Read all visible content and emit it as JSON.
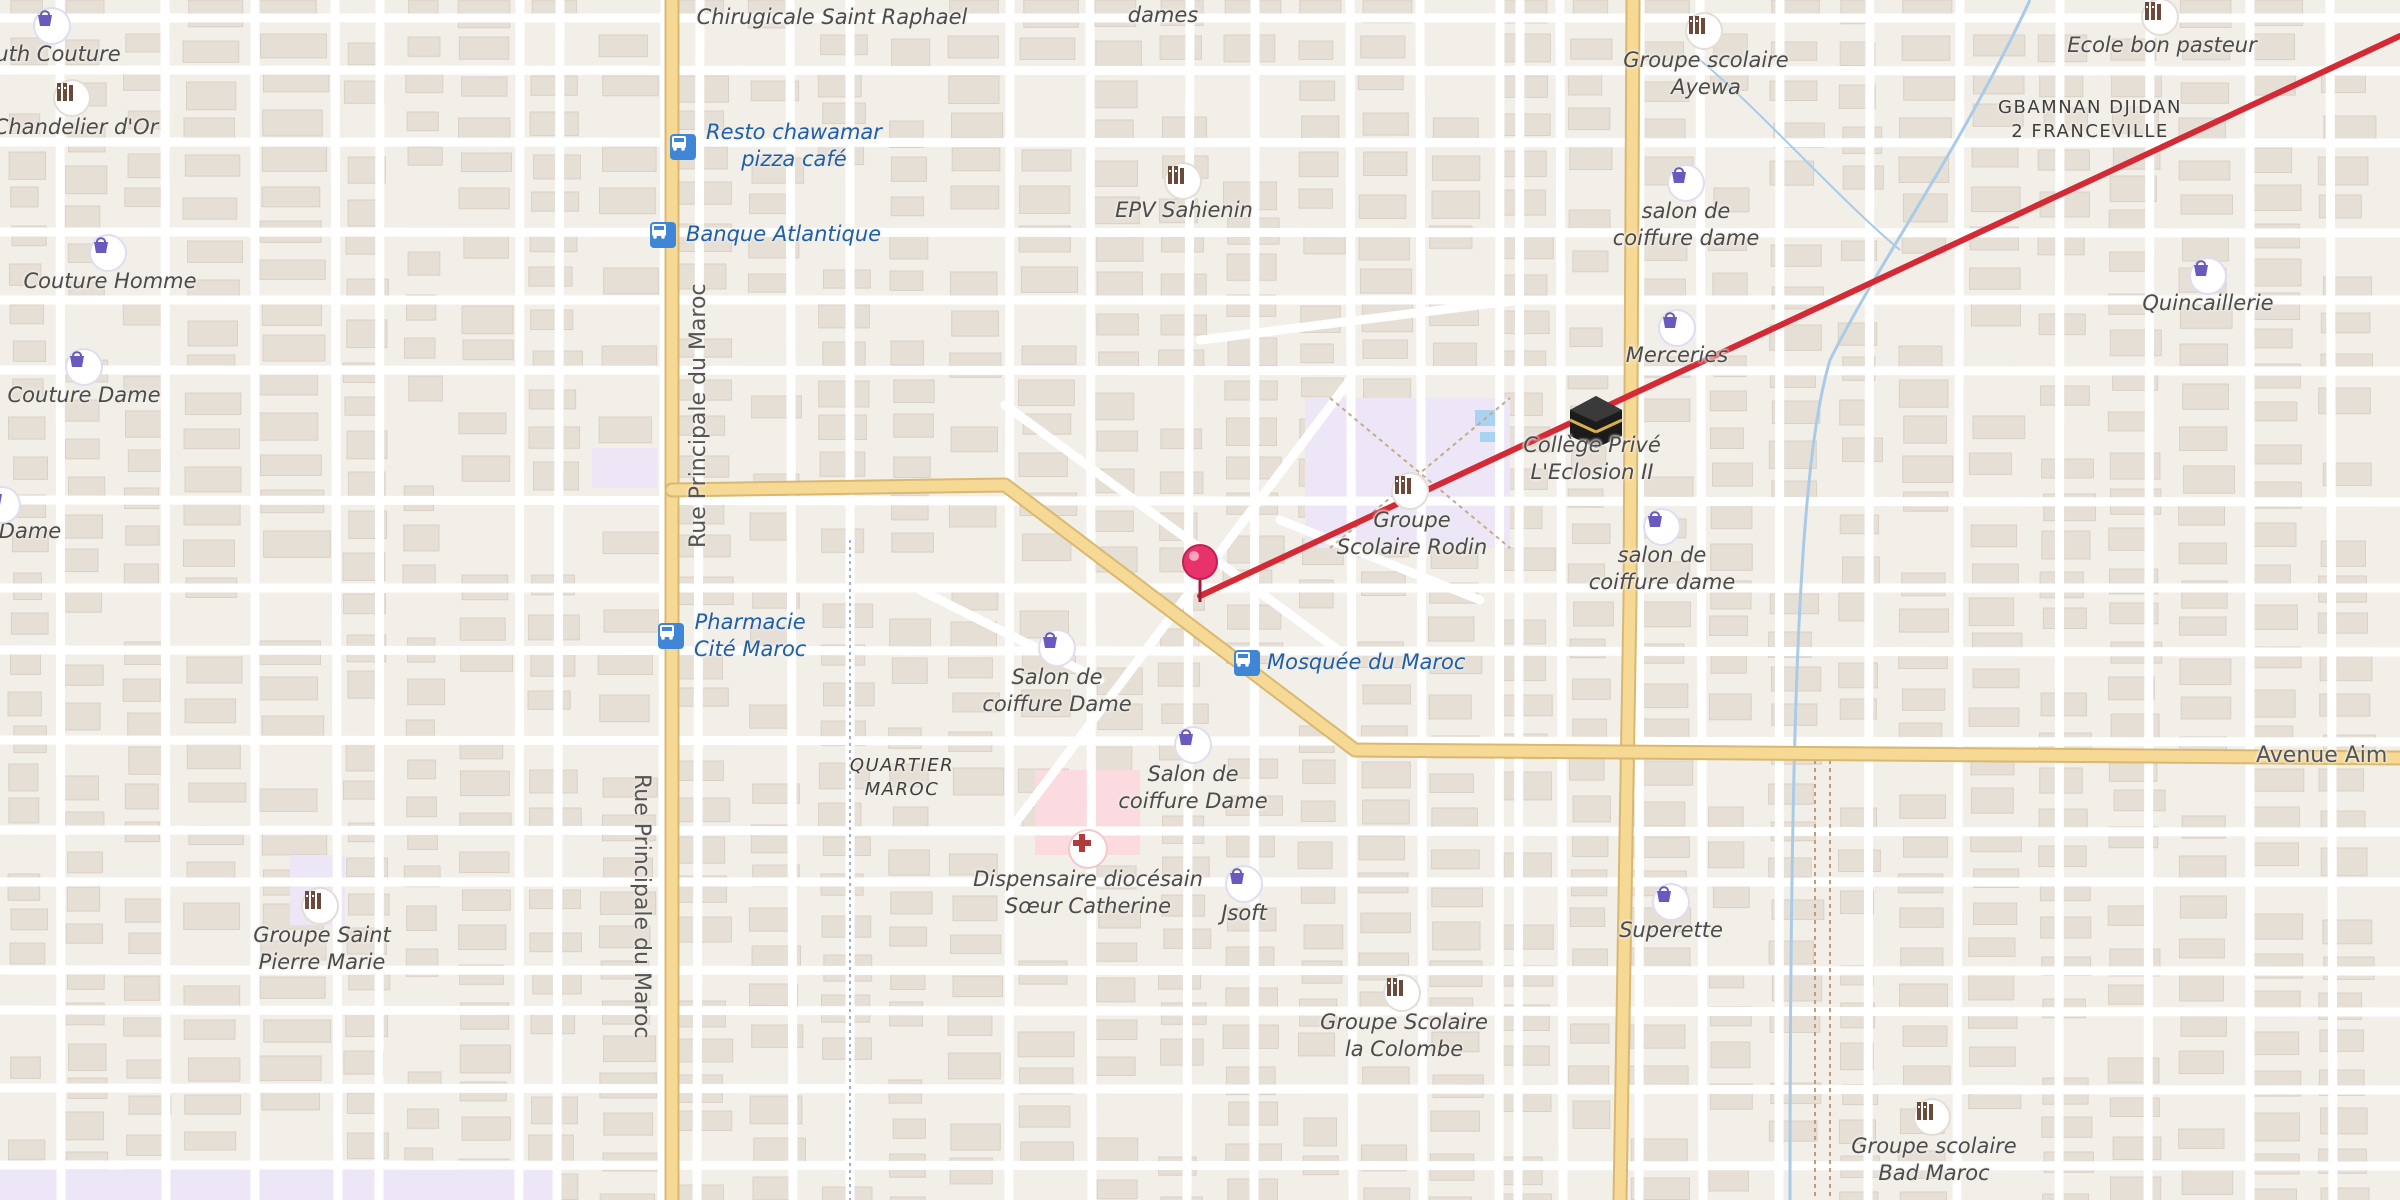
{
  "map": {
    "route_color": "#d42a35",
    "pin_color": "#e8336a",
    "major_road_color": "#f2d089",
    "minor_road_color": "#ffffff",
    "land_color": "#f2efe9",
    "building_color": "#e4dcd3"
  },
  "roads": {
    "rue_principale_top": "Rue Principale du Maroc",
    "rue_principale_bottom": "Rue Principale du Maroc",
    "avenue": "Avenue Aim"
  },
  "districts": {
    "quartier_maroc": "QUARTIER\nMAROC",
    "gbamnan": "GBAMNAN DJIDAN\n2 FRANCEVILLE"
  },
  "places": {
    "chirurgicale": "Chirugicale Saint Raphael",
    "dames": "dames",
    "ruth_couture": "uth Couture",
    "chandelier": "Chandelier d'Or",
    "couture_homme": "Couture Homme",
    "couture_dame": "Couture Dame",
    "dame_left": "Dame",
    "resto": "Resto chawamar\npizza café",
    "banque": "Banque Atlantique",
    "epv": "EPV Sahienin",
    "groupe_ayewa": "Groupe scolaire\nAyewa",
    "ecole_bon_pasteur": "Ecole bon pasteur",
    "salon_dame_1": "salon de\ncoiffure dame",
    "quincaillerie": "Quincaillerie",
    "merceries": "Merceries",
    "college": "Collège Privé\nL'Eclosion II",
    "groupe_rodin": "Groupe\nScolaire Rodin",
    "salon_dame_2": "salon de\ncoiffure dame",
    "pharmacie": "Pharmacie\nCité Maroc",
    "mosquee": "Mosquée du Maroc",
    "salon_dame_3": "Salon de\ncoiffure Dame",
    "salon_dame_4": "Salon de\ncoiffure Dame",
    "dispensaire": "Dispensaire diocésain\nSœur Catherine",
    "jsoft": "Jsoft",
    "superette": "Superette",
    "groupe_saint_pierre": "Groupe Saint\nPierre Marie",
    "groupe_colombe": "Groupe Scolaire\nla Colombe",
    "groupe_bad_maroc": "Groupe scolaire\nBad Maroc"
  }
}
